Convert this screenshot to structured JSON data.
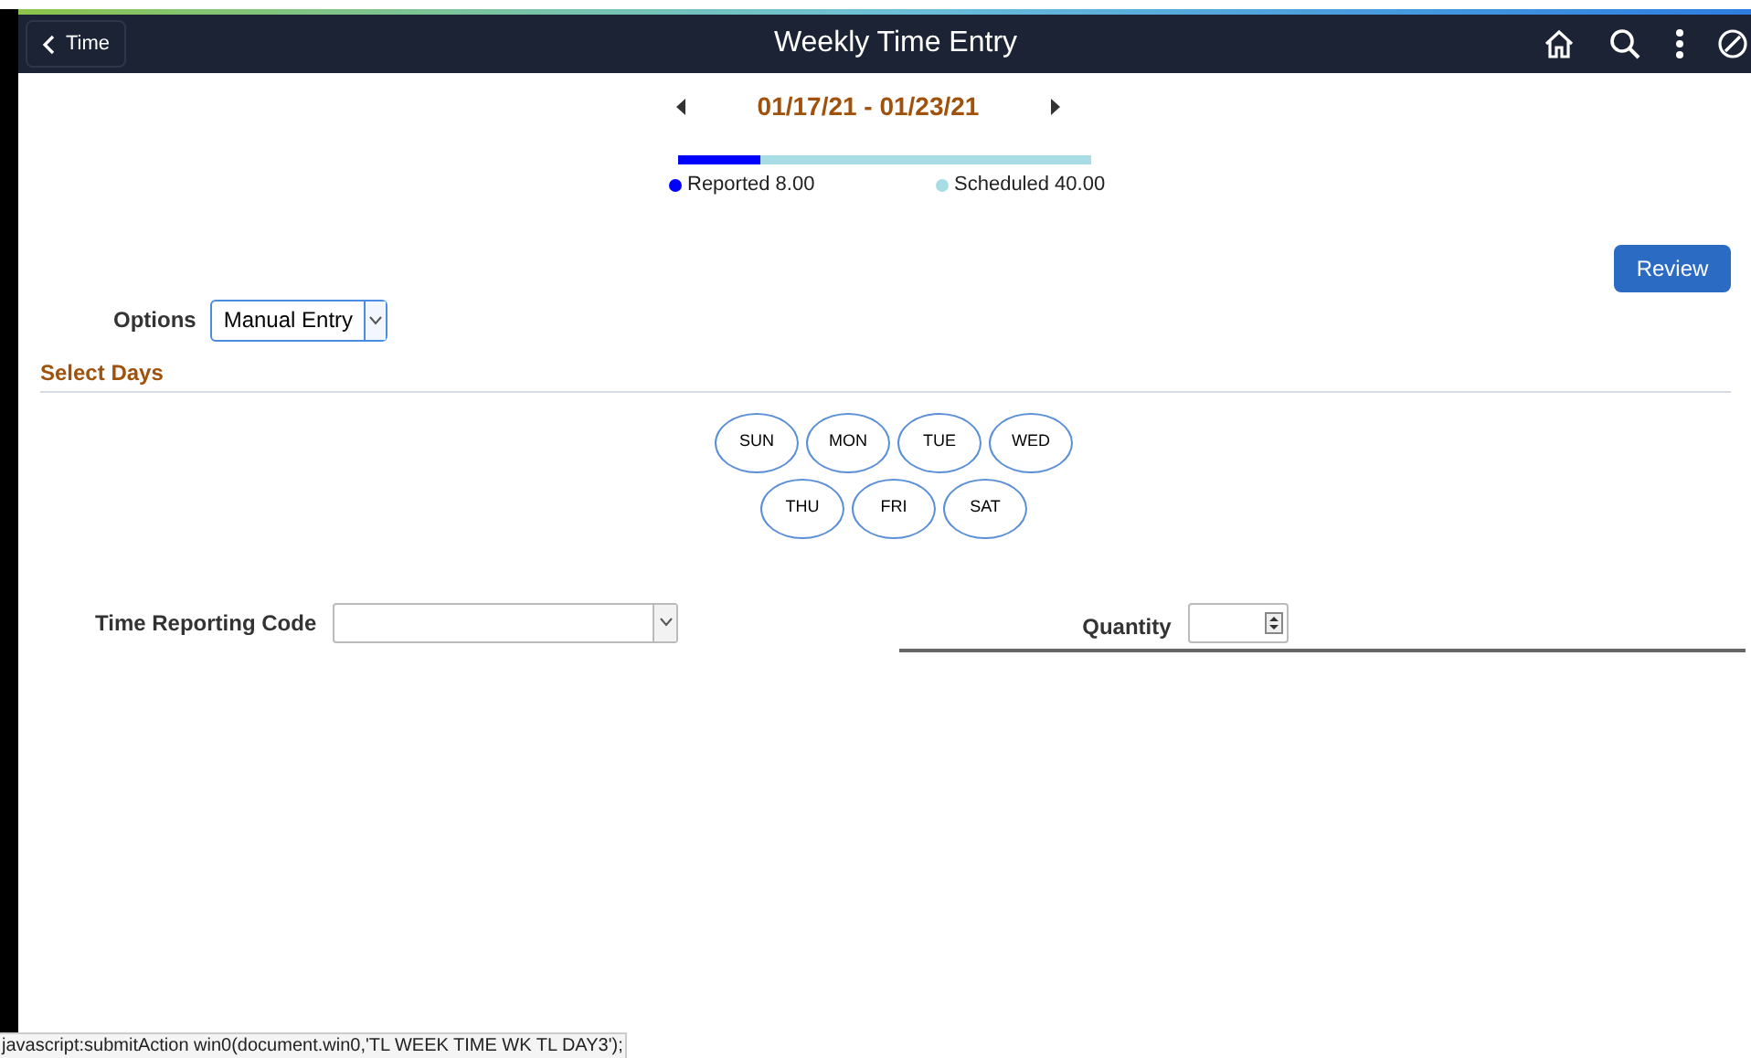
{
  "header": {
    "back_label": "Time",
    "title": "Weekly Time Entry"
  },
  "period": {
    "range": "01/17/21 - 01/23/21"
  },
  "summary": {
    "level": 0.2,
    "reported": "Reported 8.00",
    "scheduled": "Scheduled 40.00"
  },
  "review_button": "Review",
  "options": {
    "label": "Options",
    "value": "Manual Entry"
  },
  "select_days": {
    "title": "Select Days",
    "days": [
      [
        "SUN",
        "MON",
        "TUE",
        "WED"
      ],
      [
        "THU",
        "FRI",
        "SAT"
      ]
    ]
  },
  "time_reporting_code": {
    "label": "Time Reporting Code"
  },
  "quantity": {
    "label": "Quantity"
  },
  "status_bar": "javascript:submitAction win0(document.win0,'TL WEEK TIME WK TL DAY3');"
}
